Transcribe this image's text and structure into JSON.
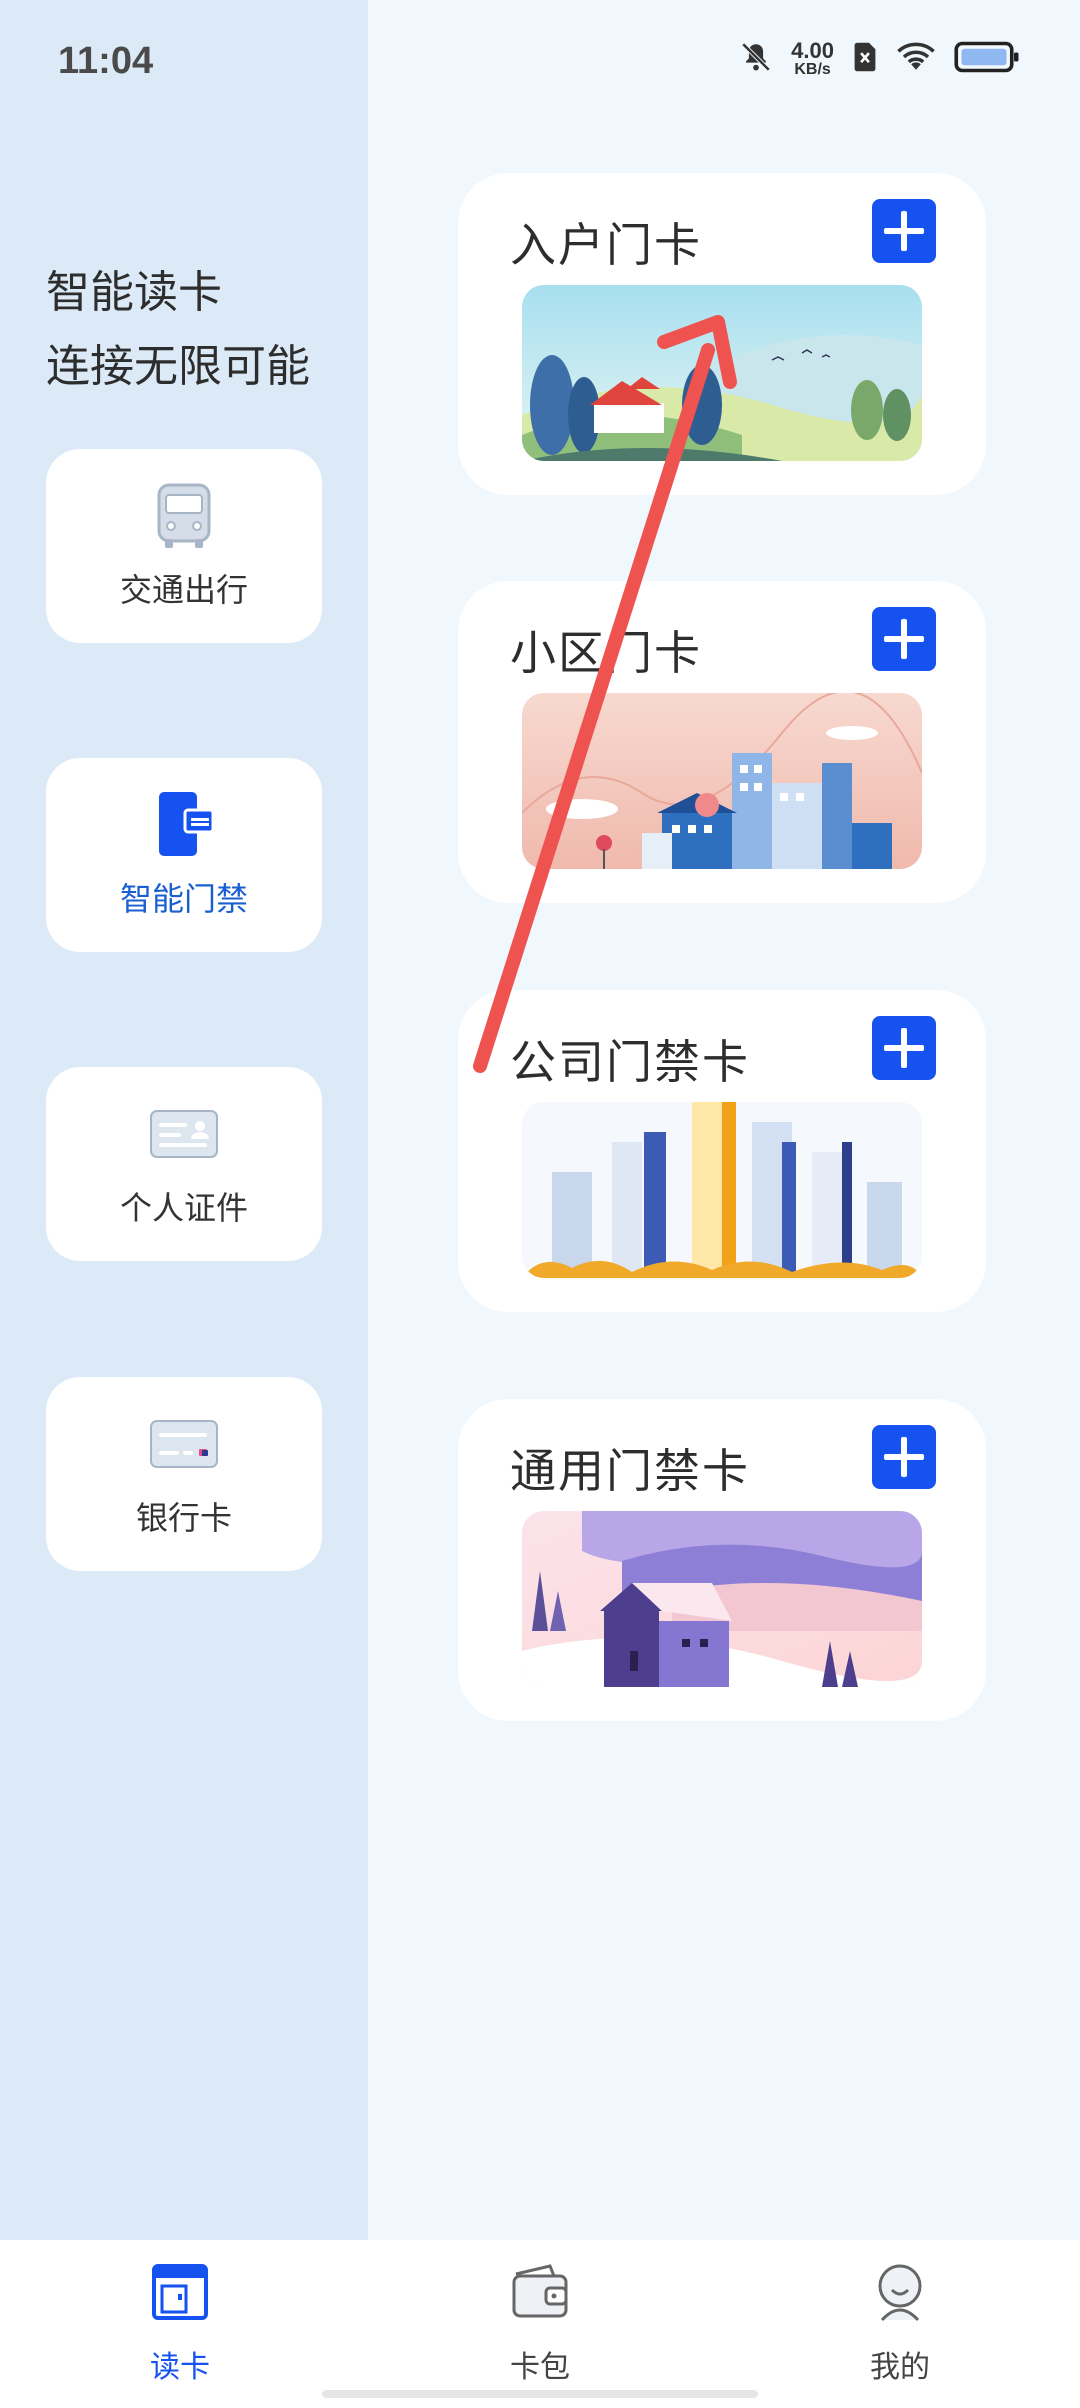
{
  "status_bar": {
    "time": "11:04",
    "net_speed_value": "4.00",
    "net_speed_unit": "KB/s",
    "icons": [
      "mute-bell-icon",
      "sim-off-icon",
      "wifi-icon",
      "battery-icon"
    ]
  },
  "sidebar": {
    "slogan_line1": "智能读卡",
    "slogan_line2": "连接无限可能",
    "categories": [
      {
        "label": "交通出行",
        "icon": "bus-icon",
        "active": false
      },
      {
        "label": "智能门禁",
        "icon": "door-card-icon",
        "active": true
      },
      {
        "label": "个人证件",
        "icon": "id-card-icon",
        "active": false
      },
      {
        "label": "银行卡",
        "icon": "bank-card-icon",
        "active": false
      }
    ]
  },
  "cards": [
    {
      "title": "入户门卡",
      "add_icon": "plus-icon",
      "image": "countryside-illustration"
    },
    {
      "title": "小区门卡",
      "add_icon": "plus-icon",
      "image": "community-illustration"
    },
    {
      "title": "公司门禁卡",
      "add_icon": "plus-icon",
      "image": "office-towers-illustration"
    },
    {
      "title": "通用门禁卡",
      "add_icon": "plus-icon",
      "image": "snow-house-illustration"
    }
  ],
  "bottom_nav": {
    "items": [
      {
        "label": "读卡",
        "icon": "card-reader-icon",
        "active": true
      },
      {
        "label": "卡包",
        "icon": "wallet-icon",
        "active": false
      },
      {
        "label": "我的",
        "icon": "profile-icon",
        "active": false
      }
    ]
  },
  "colors": {
    "accent": "#1652f0",
    "active_text": "#1a5fd1",
    "sidebar_bg": "#dbeaf6",
    "content_bg": "#f0f7fd",
    "annotation_arrow": "#ef5350"
  }
}
